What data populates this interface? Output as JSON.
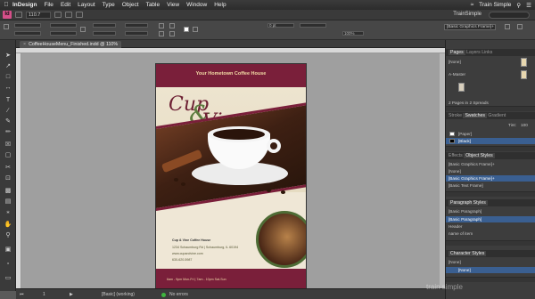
{
  "menubar": {
    "app_name": "InDesign",
    "items": [
      "File",
      "Edit",
      "Layout",
      "Type",
      "Object",
      "Table",
      "View",
      "Window",
      "Help"
    ],
    "right_title": "Train Simple"
  },
  "appbar": {
    "logo": "Id",
    "zoom": "110.7",
    "workspace": "TrainSimple"
  },
  "control": {
    "object_style": "[Basic Graphics Frame]+",
    "stroke_weight": "0 pt",
    "percent": "100%"
  },
  "document": {
    "tab_label": "CoffeeHouseMenu_Finished.indd @ 110%"
  },
  "page": {
    "header": "Your Hometown Coffee House",
    "title_word1": "Cup",
    "ampersand": "&",
    "title_word2": "Vine",
    "address_name": "Cup & Vine Coffee House",
    "address_line": "1234 Schaumburg Rd | Schaumburg, IL 60194",
    "website": "www.cupandvine.com",
    "phone": "630-620-5987",
    "hours": "6am - 9pm Mon-Fri | 7am - 10pm Sat-Sun"
  },
  "status": {
    "page": "1",
    "style": "[Basic] (working)",
    "errors": "No errors"
  },
  "panels": {
    "pages_tabs": [
      "Pages",
      "Layers",
      "Links"
    ],
    "pages_none": "[None]",
    "pages_master": "A-Master",
    "pages_footer": "2 Pages in 2 Spreads",
    "color_tabs": [
      "Stroke",
      "Swatches",
      "Gradient"
    ],
    "tint_label": "Tint:",
    "tint_value": "100",
    "swatches": [
      "[Paper]",
      "[Black]"
    ],
    "fx_tabs": [
      "Effects",
      "Object Styles"
    ],
    "object_style_header": "[Basic Graphics Frame]+",
    "object_styles": [
      "[None]",
      "[Basic Graphics Frame]+",
      "[Basic Text Frame]"
    ],
    "paragraph_tab": "Paragraph Styles",
    "paragraph_header": "[Basic Paragraph]",
    "paragraph_styles": [
      "[Basic Paragraph]",
      "Header",
      "name of item"
    ],
    "character_tab": "Character Styles",
    "character_header": "[None]",
    "character_styles": [
      "[None]"
    ]
  },
  "watermark": "train simple",
  "colors": {
    "burgundy": "#7a1f3a",
    "olive": "#5c7c3f",
    "selection": "#3a5f91",
    "status_ok": "#3fb63f"
  }
}
